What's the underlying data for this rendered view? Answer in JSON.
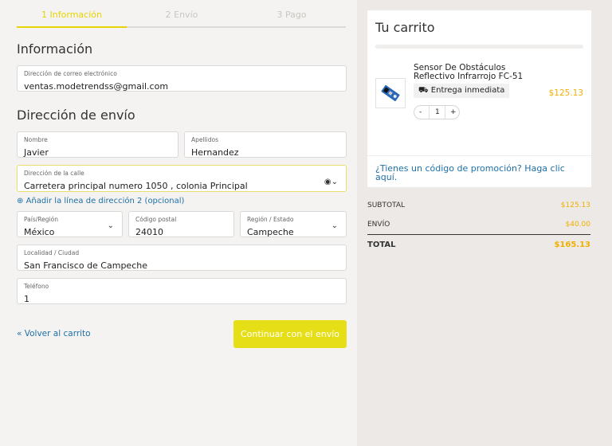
{
  "steps": [
    "1 Información",
    "2 Envío",
    "3 Pago"
  ],
  "info": {
    "title": "Información",
    "email": {
      "label": "Dirección de correo electrónico",
      "value": "ventas.modetrendss@gmail.com"
    }
  },
  "shipping": {
    "title": "Dirección de envío",
    "nombre": {
      "label": "Nombre",
      "value": "Javier"
    },
    "apellidos": {
      "label": "Apellidos",
      "value": "Hernandez"
    },
    "calle": {
      "label": "Dirección de la calle",
      "value": "Carretera principal numero 1050 , colonia Principal"
    },
    "add_line_2": "Añadir la línea de dirección 2 (opcional)",
    "pais": {
      "label": "País/Región",
      "value": "México"
    },
    "postal": {
      "label": "Código postal",
      "value": "24010"
    },
    "region": {
      "label": "Región / Estado",
      "value": "Campeche"
    },
    "localidad": {
      "label": "Localidad / Ciudad",
      "value": "San Francisco de Campeche"
    },
    "telefono": {
      "label": "Teléfono",
      "value": "1"
    }
  },
  "actions": {
    "back": "« Volver al carrito",
    "continue": "Continuar con el envío"
  },
  "cart": {
    "title": "Tu carrito",
    "product": {
      "name": "Sensor De Obstáculos Reflectivo Infrarrojo FC-51",
      "badge": "Entrega inmediata",
      "price": "$125.13",
      "qty": "1",
      "minus": "-",
      "plus": "+"
    },
    "promo": "¿Tienes un código de promoción? Haga clic aquí."
  },
  "summary": {
    "subtotal_label": "SUBTOTAL",
    "subtotal": "$125.13",
    "envio_label": "ENVÍO",
    "envio": "$40.00",
    "total_label": "TOTAL",
    "total": "$165.13"
  },
  "colors": {
    "accent": "#e6df18",
    "price": "#f0b000",
    "link": "#1d6fa5"
  },
  "icons": {
    "truck": "truck-icon",
    "person": "person-icon",
    "chevron": "chevron-down-icon"
  }
}
